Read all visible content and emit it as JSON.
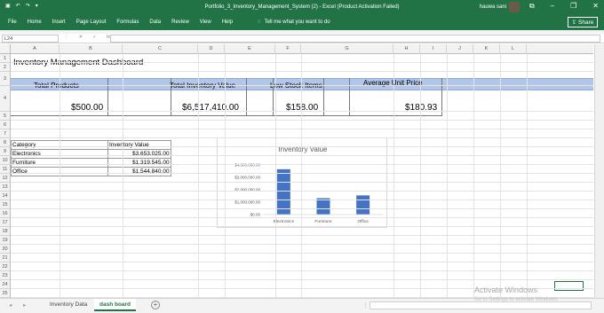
{
  "window": {
    "title": "Portfolio_3_Inventory_Management_System (2) - Excel (Product Activation Failed)",
    "user": "hauwa sani",
    "share_label": "Share"
  },
  "ribbon": {
    "tabs": [
      "File",
      "Home",
      "Insert",
      "Page Layout",
      "Formulas",
      "Data",
      "Review",
      "View",
      "Help"
    ],
    "tell_me": "Tell me what you want to do"
  },
  "formula_bar": {
    "name_box": "L24",
    "formula": ""
  },
  "columns": [
    "A",
    "B",
    "C",
    "D",
    "E",
    "F",
    "G",
    "H",
    "I",
    "J",
    "K",
    "L"
  ],
  "rows": [
    "1",
    "2",
    "3",
    "4",
    "5",
    "6",
    "7",
    "8",
    "9",
    "10",
    "11",
    "12",
    "13",
    "14",
    "15",
    "16",
    "17",
    "18",
    "19",
    "20",
    "21",
    "22",
    "23",
    "24",
    "25"
  ],
  "dashboard": {
    "title": "Inventory Management Dashboard",
    "kpis": [
      {
        "label": "Total Products",
        "value": "$500.00"
      },
      {
        "label": "Total Inventory Value",
        "value": "$6,517,410.00"
      },
      {
        "label": "Low Stock Items",
        "value": "$158.00"
      },
      {
        "label": "Average Unit Price",
        "value": "$180.93"
      }
    ],
    "table": {
      "headers": [
        "Category",
        "Inventory Value"
      ],
      "rows": [
        [
          "Electronics",
          "$3,653,025.00"
        ],
        [
          "Furniture",
          "$1,319,545.00"
        ],
        [
          "Office",
          "$1,544,840.00"
        ]
      ]
    }
  },
  "chart_data": {
    "type": "bar",
    "title": "Inventory Value",
    "categories": [
      "Electronics",
      "Furniture",
      "Office"
    ],
    "values": [
      3653025,
      1319545,
      1544840
    ],
    "ylim": [
      0,
      4000000
    ],
    "yticks": [
      "$0.00",
      "$1,000,000.00",
      "$2,000,000.00",
      "$3,000,000.00",
      "$4,000,000.00"
    ],
    "bar_color": "#4472c4",
    "grid": false,
    "legend": "none"
  },
  "sheets": {
    "tabs": [
      "Inventory Data",
      "dash board"
    ],
    "active": "dash board"
  },
  "watermark": {
    "line1": "Activate Windows",
    "line2": "Go to Settings to activate Windows."
  }
}
